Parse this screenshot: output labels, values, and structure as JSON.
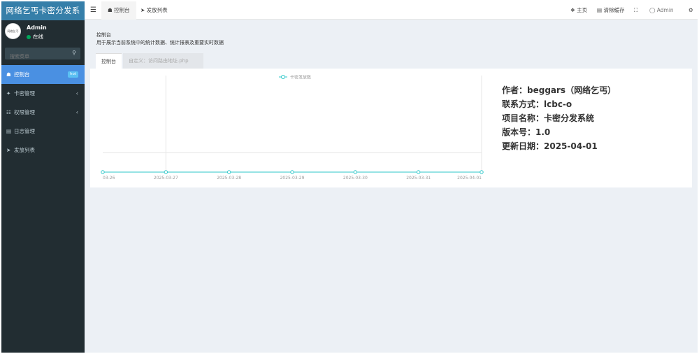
{
  "sidebar": {
    "brand": "网络乞丐卡密分发系",
    "user": {
      "name": "Admin",
      "status": "在线",
      "avatar_text": "网络乞丐"
    },
    "search": {
      "placeholder": "搜索菜单"
    },
    "items": [
      {
        "label": "控制台",
        "icon": "dashboard-icon",
        "badge": "hot",
        "active": true
      },
      {
        "label": "卡密管理",
        "icon": "cards-icon",
        "has_children": true
      },
      {
        "label": "权限管理",
        "icon": "lock-icon",
        "has_children": true
      },
      {
        "label": "日志管理",
        "icon": "log-icon"
      },
      {
        "label": "发放列表",
        "icon": "send-icon"
      }
    ]
  },
  "topbar": {
    "tab_dashboard": "控制台",
    "tab_dispatch": "发放列表",
    "home": "主页",
    "clear_cache": "清除缓存",
    "admin": "Admin"
  },
  "content": {
    "title": "控制台",
    "description": "用于展示当前系统中的统计数据、统计报表及重要实时数据",
    "tabs": [
      "控制台",
      "自定义：访问路由地址.php"
    ]
  },
  "info": {
    "author": "作者：beggars（网络乞丐）",
    "contact": "联系方式：lcbc-o",
    "project": "项目名称：卡密分发系统",
    "version": "版本号：1.0",
    "updated": "更新日期：2025-04-01"
  },
  "chart_data": {
    "type": "line",
    "legend": "卡密发放数",
    "x": [
      "03-26",
      "2025-03-27",
      "2025-03-28",
      "2025-03-29",
      "2025-03-30",
      "2025-03-31",
      "2025-04-01"
    ],
    "series": [
      {
        "name": "卡密发放数",
        "values": [
          0,
          0,
          0,
          0,
          0,
          0,
          0
        ]
      }
    ],
    "color": "#2ec7c9"
  }
}
